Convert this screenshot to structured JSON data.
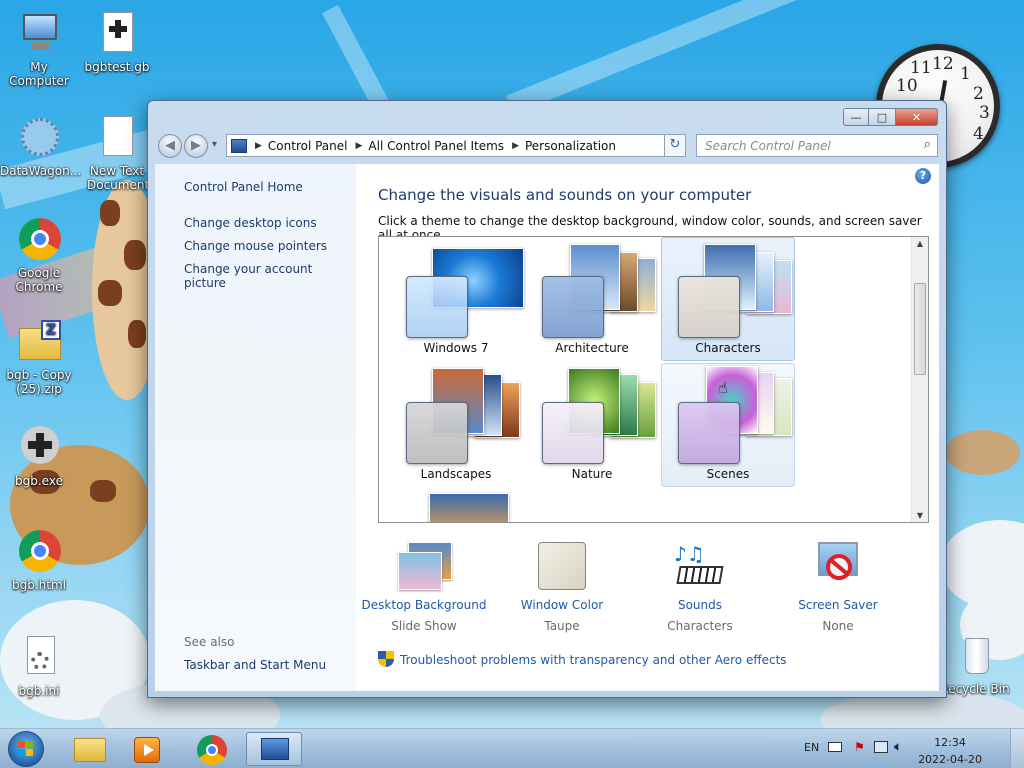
{
  "desktop": {
    "icons": [
      {
        "label": "My Computer",
        "icon": "computer-icon"
      },
      {
        "label": "bgbtest.gb",
        "icon": "gameboy-file-icon"
      },
      {
        "label": "DataWagon...",
        "icon": "datawagon-icon"
      },
      {
        "label": "New Text Document.txt",
        "icon": "text-file-icon"
      },
      {
        "label": "Google Chrome",
        "icon": "chrome-icon"
      },
      {
        "label": "bgb - Copy (25).zip",
        "icon": "zip-folder-icon"
      },
      {
        "label": "bgb.exe",
        "icon": "bgb-exe-icon"
      },
      {
        "label": "bgb.html",
        "icon": "chrome-html-icon"
      },
      {
        "label": "bgb.ini",
        "icon": "settings-file-icon"
      },
      {
        "label": "Recycle Bin",
        "icon": "recycle-bin-icon"
      }
    ],
    "clock": {
      "numbers": [
        "12",
        "1",
        "2",
        "3",
        "4",
        "10",
        "11"
      ]
    }
  },
  "window": {
    "buttons": {
      "minimize": "—",
      "maximize": "□",
      "close": "✕"
    },
    "nav": {
      "back": "◀",
      "forward": "▶",
      "dropdown": "▾"
    },
    "address": {
      "crumbs": [
        "Control Panel",
        "All Control Panel Items",
        "Personalization"
      ]
    },
    "search": {
      "placeholder": "Search Control Panel"
    },
    "sidebar": {
      "home": "Control Panel Home",
      "links": [
        "Change desktop icons",
        "Change mouse pointers",
        "Change your account picture"
      ],
      "see_also": "See also",
      "see_also_links": [
        "Taskbar and Start Menu"
      ]
    },
    "main": {
      "help": "?",
      "title": "Change the visuals and sounds on your computer",
      "subtitle": "Click a theme to change the desktop background, window color, sounds, and screen saver all at once.",
      "themes": [
        "Windows 7",
        "Architecture",
        "Characters",
        "Landscapes",
        "Nature",
        "Scenes"
      ],
      "selected_theme": "Characters",
      "bottom": [
        {
          "title": "Desktop Background",
          "value": "Slide Show"
        },
        {
          "title": "Window Color",
          "value": "Taupe"
        },
        {
          "title": "Sounds",
          "value": "Characters"
        },
        {
          "title": "Screen Saver",
          "value": "None"
        }
      ],
      "troubleshoot": "Troubleshoot problems with transparency and other Aero effects"
    }
  },
  "taskbar": {
    "items": [
      "start-button",
      "windows-explorer",
      "media-player",
      "google-chrome",
      "control-panel"
    ],
    "lang": "EN",
    "time": "12:34",
    "date": "2022-04-20"
  },
  "colors": {
    "link": "#1e5aa8",
    "heading": "#1e3a6e",
    "desktop": "#2aa6e6"
  }
}
